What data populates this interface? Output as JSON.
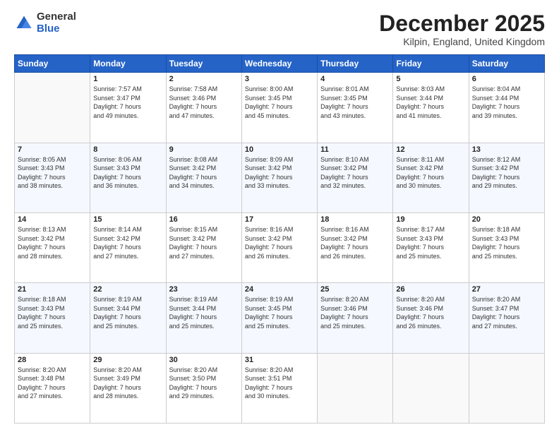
{
  "logo": {
    "general": "General",
    "blue": "Blue"
  },
  "header": {
    "month": "December 2025",
    "location": "Kilpin, England, United Kingdom"
  },
  "weekdays": [
    "Sunday",
    "Monday",
    "Tuesday",
    "Wednesday",
    "Thursday",
    "Friday",
    "Saturday"
  ],
  "weeks": [
    [
      {
        "day": "",
        "info": ""
      },
      {
        "day": "1",
        "info": "Sunrise: 7:57 AM\nSunset: 3:47 PM\nDaylight: 7 hours\nand 49 minutes."
      },
      {
        "day": "2",
        "info": "Sunrise: 7:58 AM\nSunset: 3:46 PM\nDaylight: 7 hours\nand 47 minutes."
      },
      {
        "day": "3",
        "info": "Sunrise: 8:00 AM\nSunset: 3:45 PM\nDaylight: 7 hours\nand 45 minutes."
      },
      {
        "day": "4",
        "info": "Sunrise: 8:01 AM\nSunset: 3:45 PM\nDaylight: 7 hours\nand 43 minutes."
      },
      {
        "day": "5",
        "info": "Sunrise: 8:03 AM\nSunset: 3:44 PM\nDaylight: 7 hours\nand 41 minutes."
      },
      {
        "day": "6",
        "info": "Sunrise: 8:04 AM\nSunset: 3:44 PM\nDaylight: 7 hours\nand 39 minutes."
      }
    ],
    [
      {
        "day": "7",
        "info": "Sunrise: 8:05 AM\nSunset: 3:43 PM\nDaylight: 7 hours\nand 38 minutes."
      },
      {
        "day": "8",
        "info": "Sunrise: 8:06 AM\nSunset: 3:43 PM\nDaylight: 7 hours\nand 36 minutes."
      },
      {
        "day": "9",
        "info": "Sunrise: 8:08 AM\nSunset: 3:42 PM\nDaylight: 7 hours\nand 34 minutes."
      },
      {
        "day": "10",
        "info": "Sunrise: 8:09 AM\nSunset: 3:42 PM\nDaylight: 7 hours\nand 33 minutes."
      },
      {
        "day": "11",
        "info": "Sunrise: 8:10 AM\nSunset: 3:42 PM\nDaylight: 7 hours\nand 32 minutes."
      },
      {
        "day": "12",
        "info": "Sunrise: 8:11 AM\nSunset: 3:42 PM\nDaylight: 7 hours\nand 30 minutes."
      },
      {
        "day": "13",
        "info": "Sunrise: 8:12 AM\nSunset: 3:42 PM\nDaylight: 7 hours\nand 29 minutes."
      }
    ],
    [
      {
        "day": "14",
        "info": "Sunrise: 8:13 AM\nSunset: 3:42 PM\nDaylight: 7 hours\nand 28 minutes."
      },
      {
        "day": "15",
        "info": "Sunrise: 8:14 AM\nSunset: 3:42 PM\nDaylight: 7 hours\nand 27 minutes."
      },
      {
        "day": "16",
        "info": "Sunrise: 8:15 AM\nSunset: 3:42 PM\nDaylight: 7 hours\nand 27 minutes."
      },
      {
        "day": "17",
        "info": "Sunrise: 8:16 AM\nSunset: 3:42 PM\nDaylight: 7 hours\nand 26 minutes."
      },
      {
        "day": "18",
        "info": "Sunrise: 8:16 AM\nSunset: 3:42 PM\nDaylight: 7 hours\nand 26 minutes."
      },
      {
        "day": "19",
        "info": "Sunrise: 8:17 AM\nSunset: 3:43 PM\nDaylight: 7 hours\nand 25 minutes."
      },
      {
        "day": "20",
        "info": "Sunrise: 8:18 AM\nSunset: 3:43 PM\nDaylight: 7 hours\nand 25 minutes."
      }
    ],
    [
      {
        "day": "21",
        "info": "Sunrise: 8:18 AM\nSunset: 3:43 PM\nDaylight: 7 hours\nand 25 minutes."
      },
      {
        "day": "22",
        "info": "Sunrise: 8:19 AM\nSunset: 3:44 PM\nDaylight: 7 hours\nand 25 minutes."
      },
      {
        "day": "23",
        "info": "Sunrise: 8:19 AM\nSunset: 3:44 PM\nDaylight: 7 hours\nand 25 minutes."
      },
      {
        "day": "24",
        "info": "Sunrise: 8:19 AM\nSunset: 3:45 PM\nDaylight: 7 hours\nand 25 minutes."
      },
      {
        "day": "25",
        "info": "Sunrise: 8:20 AM\nSunset: 3:46 PM\nDaylight: 7 hours\nand 25 minutes."
      },
      {
        "day": "26",
        "info": "Sunrise: 8:20 AM\nSunset: 3:46 PM\nDaylight: 7 hours\nand 26 minutes."
      },
      {
        "day": "27",
        "info": "Sunrise: 8:20 AM\nSunset: 3:47 PM\nDaylight: 7 hours\nand 27 minutes."
      }
    ],
    [
      {
        "day": "28",
        "info": "Sunrise: 8:20 AM\nSunset: 3:48 PM\nDaylight: 7 hours\nand 27 minutes."
      },
      {
        "day": "29",
        "info": "Sunrise: 8:20 AM\nSunset: 3:49 PM\nDaylight: 7 hours\nand 28 minutes."
      },
      {
        "day": "30",
        "info": "Sunrise: 8:20 AM\nSunset: 3:50 PM\nDaylight: 7 hours\nand 29 minutes."
      },
      {
        "day": "31",
        "info": "Sunrise: 8:20 AM\nSunset: 3:51 PM\nDaylight: 7 hours\nand 30 minutes."
      },
      {
        "day": "",
        "info": ""
      },
      {
        "day": "",
        "info": ""
      },
      {
        "day": "",
        "info": ""
      }
    ]
  ]
}
